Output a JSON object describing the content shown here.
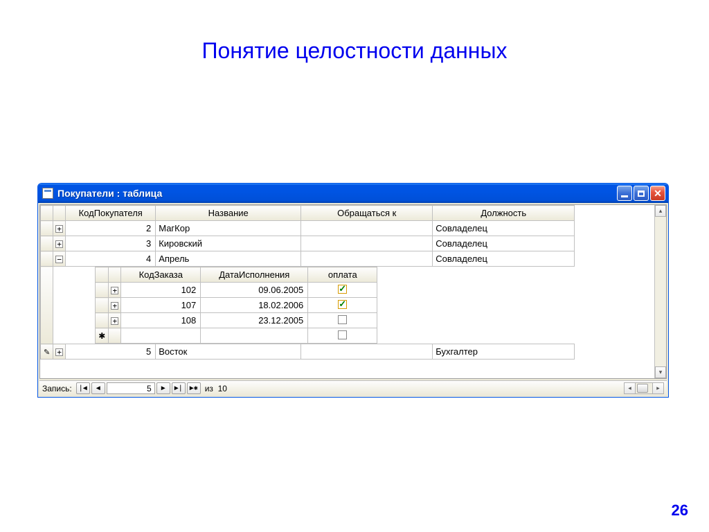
{
  "slide": {
    "title": "Понятие целостности данных",
    "page_number": "26"
  },
  "window": {
    "title": "Покупатели : таблица"
  },
  "main_table": {
    "columns": [
      "КодПокупателя",
      "Название",
      "Обращаться к",
      "Должность"
    ],
    "rows": [
      {
        "expand": "+",
        "id": "2",
        "name": "МагКор",
        "contact": "",
        "position": "Совладелец"
      },
      {
        "expand": "+",
        "id": "3",
        "name": "Кировский",
        "contact": "",
        "position": "Совладелец"
      },
      {
        "expand": "−",
        "id": "4",
        "name": "Апрель",
        "contact": "",
        "position": "Совладелец"
      },
      {
        "expand": "+",
        "id": "5",
        "name": "Восток",
        "contact": "",
        "position": "Бухгалтер"
      }
    ]
  },
  "sub_table": {
    "columns": [
      "КодЗаказа",
      "ДатаИсполнения",
      "оплата"
    ],
    "rows": [
      {
        "expand": "+",
        "order": "102",
        "date": "09.06.2005",
        "paid": true
      },
      {
        "expand": "+",
        "order": "107",
        "date": "18.02.2006",
        "paid": true
      },
      {
        "expand": "+",
        "order": "108",
        "date": "23.12.2005",
        "paid": false
      }
    ],
    "new_marker": "✱"
  },
  "nav": {
    "label": "Запись:",
    "current": "5",
    "of_label": "из",
    "total": "10",
    "first": "|◀",
    "prev": "◀",
    "next": "▶",
    "last": "▶|",
    "new": "▶✱"
  }
}
